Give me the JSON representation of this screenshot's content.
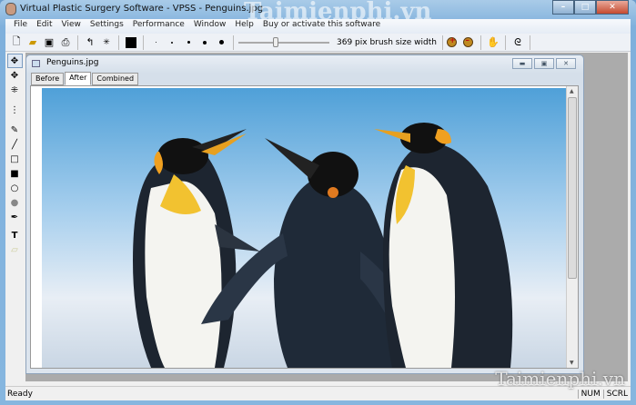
{
  "window": {
    "title": "Virtual Plastic Surgery Software - VPSS - Penguins.jpg"
  },
  "menu": [
    "File",
    "Edit",
    "View",
    "Settings",
    "Performance",
    "Window",
    "Help",
    "Buy or activate this software"
  ],
  "toolbar": {
    "brush_label": "369 pix brush size width",
    "brush_slider_fraction": 0.38,
    "color": "#000000"
  },
  "child": {
    "title": "Penguins.jpg",
    "tabs": [
      "Before",
      "After",
      "Combined"
    ],
    "active_tab": "After"
  },
  "status": {
    "text": "Ready",
    "num": "NUM",
    "scrl": "SCRL"
  },
  "watermark": "Taimienphi.vn"
}
